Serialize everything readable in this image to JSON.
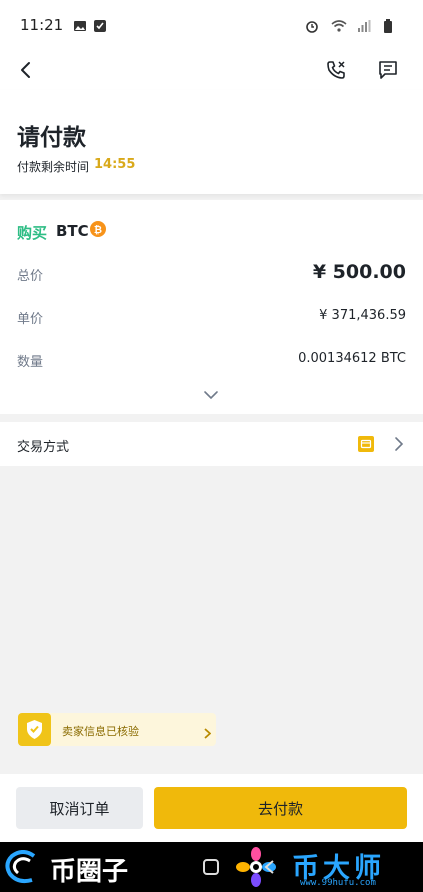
{
  "status_bar": {
    "time": "11:21"
  },
  "header": {
    "title": "请付款",
    "countdown_label": "付款剩余时间",
    "countdown_value": "14:55"
  },
  "order": {
    "side": "购买",
    "asset": "BTC",
    "rows": [
      {
        "label": "总价",
        "value": "¥ 500.00"
      },
      {
        "label": "单价",
        "value": "¥ 371,436.59"
      },
      {
        "label": "数量",
        "value": "0.00134612 BTC"
      }
    ]
  },
  "payment": {
    "label": "交易方式"
  },
  "verified_banner": {
    "text": "卖家信息已核验"
  },
  "actions": {
    "cancel_label": "取消订单",
    "pay_label": "去付款"
  },
  "watermarks": {
    "left_text": "币圈子",
    "right_text": "币大师",
    "right_url": "www.99hufu.com"
  },
  "colors": {
    "buy_green": "#2ebd85",
    "accent_yellow": "#f0b90b",
    "countdown": "#d9a91a"
  }
}
